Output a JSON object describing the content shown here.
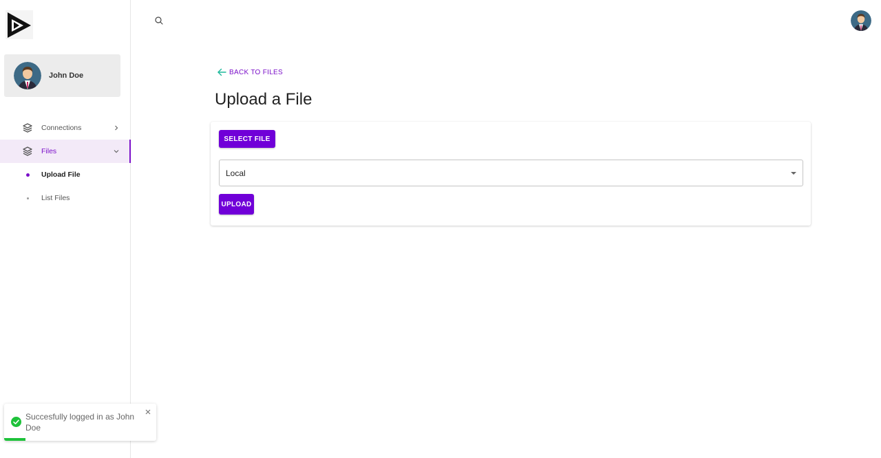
{
  "sidebar": {
    "logo_icon": "play-triangle-logo",
    "user": {
      "name": "John Doe",
      "avatar_icon": "person-avatar-icon"
    },
    "nav": [
      {
        "label": "Connections",
        "icon": "layers-icon",
        "expanded": false
      },
      {
        "label": "Files",
        "icon": "layers-icon",
        "expanded": true,
        "active": true,
        "children": [
          {
            "label": "Upload File",
            "current": true
          },
          {
            "label": "List Files",
            "current": false
          }
        ]
      }
    ]
  },
  "topbar": {
    "search_icon": "search-icon",
    "avatar_icon": "person-avatar-icon"
  },
  "main": {
    "back_label": "BACK TO FILES",
    "title": "Upload a File",
    "select_file_label": "SELECT FILE",
    "storage_select": {
      "value": "Local"
    },
    "upload_label": "UPLOAD"
  },
  "toast": {
    "message": "Succesfully logged in as John Doe",
    "icon": "check-circle-icon",
    "progress": 0.14
  },
  "colors": {
    "accent": "#7000d8",
    "accent_text": "#7b10c9",
    "back_arrow": "#1bb89a",
    "success": "#1ec23a"
  }
}
